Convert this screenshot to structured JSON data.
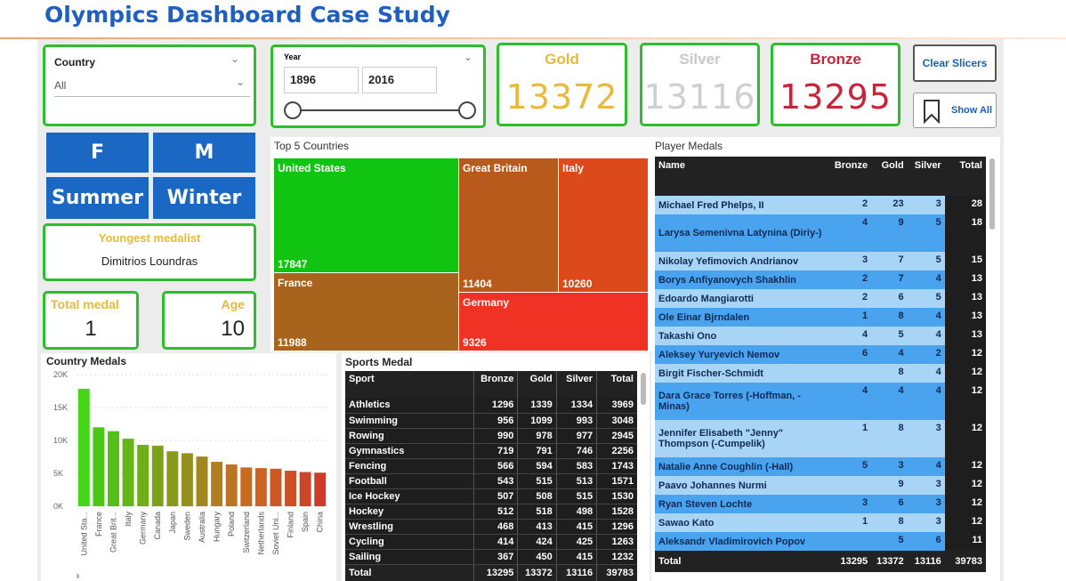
{
  "header": {
    "title": "Olympics Dashboard Case Study"
  },
  "slicers": {
    "country": {
      "label": "Country",
      "value": "All"
    },
    "year": {
      "label": "Year",
      "from": "1896",
      "to": "2016"
    },
    "clear_label": "Clear Slicers",
    "show_all_label": "Show All"
  },
  "kpis": {
    "gold": {
      "label": "Gold",
      "value": "13372",
      "color": "#e8b93a"
    },
    "silver": {
      "label": "Silver",
      "value": "13116",
      "color": "#c8c8c8"
    },
    "bronze": {
      "label": "Bronze",
      "value": "13295",
      "color": "#c8243a"
    }
  },
  "buttons": {
    "f": "F",
    "m": "M",
    "summer": "Summer",
    "winter": "Winter"
  },
  "youngest": {
    "label": "Youngest medalist",
    "name": "Dimitrios Loundras"
  },
  "total_medal": {
    "label": "Total medal",
    "value": "1"
  },
  "age": {
    "label": "Age",
    "value": "10"
  },
  "top5": {
    "title": "Top 5 Countries",
    "items": [
      {
        "name": "United States",
        "value": "17847",
        "color": "#12c412"
      },
      {
        "name": "France",
        "value": "11988",
        "color": "#a8641c"
      },
      {
        "name": "Great Britain",
        "value": "11404",
        "color": "#b85a1c"
      },
      {
        "name": "Italy",
        "value": "10260",
        "color": "#dc4a1c"
      },
      {
        "name": "Germany",
        "value": "9326",
        "color": "#ef3224"
      }
    ]
  },
  "player_medals": {
    "title": "Player Medals",
    "columns": [
      "Name",
      "Bronze",
      "Gold",
      "Silver",
      "Total"
    ],
    "rows": [
      [
        "Michael Fred Phelps, II",
        "2",
        "23",
        "3",
        "28"
      ],
      [
        "Larysa Semenivna Latynina (Diriy-)",
        "4",
        "9",
        "5",
        "18"
      ],
      [
        "Nikolay Yefimovich Andrianov",
        "3",
        "7",
        "5",
        "15"
      ],
      [
        "Borys Anfiyanovych Shakhlin",
        "2",
        "7",
        "4",
        "13"
      ],
      [
        "Edoardo Mangiarotti",
        "2",
        "6",
        "5",
        "13"
      ],
      [
        "Ole Einar Bjrndalen",
        "1",
        "8",
        "4",
        "13"
      ],
      [
        "Takashi Ono",
        "4",
        "5",
        "4",
        "13"
      ],
      [
        "Aleksey Yuryevich Nemov",
        "6",
        "4",
        "2",
        "12"
      ],
      [
        "Birgit Fischer-Schmidt",
        "",
        "8",
        "4",
        "12"
      ],
      [
        "Dara Grace Torres (-Hoffman, -Minas)",
        "4",
        "4",
        "4",
        "12"
      ],
      [
        "Jennifer Elisabeth \"Jenny\" Thompson (-Cumpelik)",
        "1",
        "8",
        "3",
        "12"
      ],
      [
        "Natalie Anne Coughlin (-Hall)",
        "5",
        "3",
        "4",
        "12"
      ],
      [
        "Paavo Johannes Nurmi",
        "",
        "9",
        "3",
        "12"
      ],
      [
        "Ryan Steven Lochte",
        "3",
        "6",
        "3",
        "12"
      ],
      [
        "Sawao Kato",
        "1",
        "8",
        "3",
        "12"
      ],
      [
        "Aleksandr Vladimirovich Popov",
        "",
        "5",
        "6",
        "11"
      ]
    ],
    "total": [
      "Total",
      "13295",
      "13372",
      "13116",
      "39783"
    ]
  },
  "sports_medal": {
    "title": "Sports Medal",
    "columns": [
      "Sport",
      "Bronze",
      "Gold",
      "Silver",
      "Total"
    ],
    "rows": [
      [
        "Athletics",
        "1296",
        "1339",
        "1334",
        "3969"
      ],
      [
        "Swimming",
        "956",
        "1099",
        "993",
        "3048"
      ],
      [
        "Rowing",
        "990",
        "978",
        "977",
        "2945"
      ],
      [
        "Gymnastics",
        "719",
        "791",
        "746",
        "2256"
      ],
      [
        "Fencing",
        "566",
        "594",
        "583",
        "1743"
      ],
      [
        "Football",
        "543",
        "515",
        "513",
        "1571"
      ],
      [
        "Ice Hockey",
        "507",
        "508",
        "515",
        "1530"
      ],
      [
        "Hockey",
        "512",
        "518",
        "498",
        "1528"
      ],
      [
        "Wrestling",
        "468",
        "413",
        "415",
        "1296"
      ],
      [
        "Cycling",
        "414",
        "424",
        "425",
        "1263"
      ],
      [
        "Sailing",
        "367",
        "450",
        "415",
        "1232"
      ]
    ],
    "total": [
      "Total",
      "13295",
      "13372",
      "13116",
      "39783"
    ]
  },
  "chart_data": {
    "type": "bar",
    "title": "Country Medals",
    "categories": [
      "United Sta...",
      "France",
      "Great Brit...",
      "Italy",
      "Germany",
      "Canada",
      "Japan",
      "Sweden",
      "Australia",
      "Hungary",
      "Poland",
      "Switzerland",
      "Netherlands",
      "Soviet Uni...",
      "Finland",
      "Spain",
      "China"
    ],
    "values": [
      17847,
      11988,
      11404,
      10260,
      9326,
      9200,
      8350,
      8050,
      7550,
      6750,
      6350,
      5900,
      5800,
      5700,
      5400,
      5200,
      5100
    ],
    "yticks": [
      "20K",
      "15K",
      "10K",
      "5K",
      "0K"
    ],
    "ylim": [
      0,
      20000
    ],
    "grid": true
  }
}
